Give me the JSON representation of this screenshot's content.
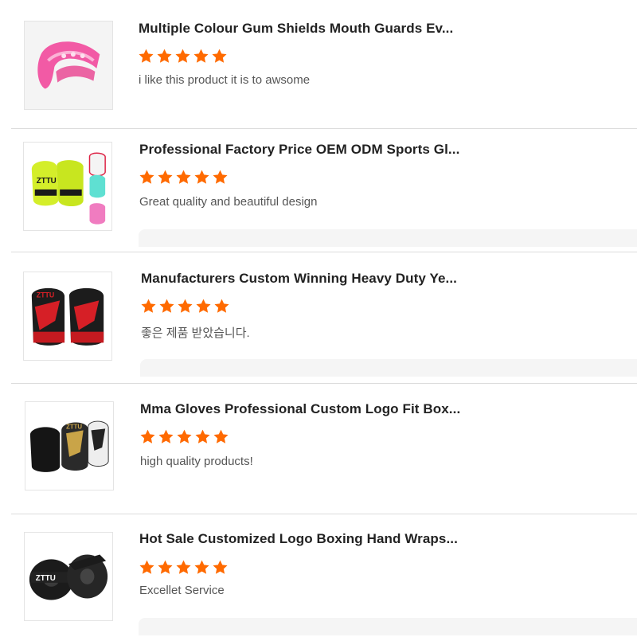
{
  "reviews": [
    {
      "title": "Multiple Colour Gum Shields Mouth Guards Ev...",
      "rating": 5,
      "comment": "i like this product it is to awsome",
      "image_icon": "mouth-guard-icon"
    },
    {
      "title": "Professional Factory Price OEM ODM Sports Gl...",
      "rating": 5,
      "comment": "Great quality and beautiful design",
      "image_icon": "boxing-gloves-neon-icon"
    },
    {
      "title": "Manufacturers Custom Winning Heavy Duty Ye...",
      "rating": 5,
      "comment": "좋은 제품 받았습니다.",
      "image_icon": "boxing-gloves-red-icon"
    },
    {
      "title": "Mma Gloves Professional Custom Logo Fit Box...",
      "rating": 5,
      "comment": "high quality products!",
      "image_icon": "boxing-gloves-trio-icon"
    },
    {
      "title": "Hot Sale Customized Logo Boxing Hand Wraps...",
      "rating": 5,
      "comment": "Excellet Service",
      "image_icon": "hand-wraps-icon"
    }
  ],
  "colors": {
    "star": "#ff6a00",
    "title": "#222222",
    "comment": "#555555",
    "divider": "#dcdcdc"
  }
}
